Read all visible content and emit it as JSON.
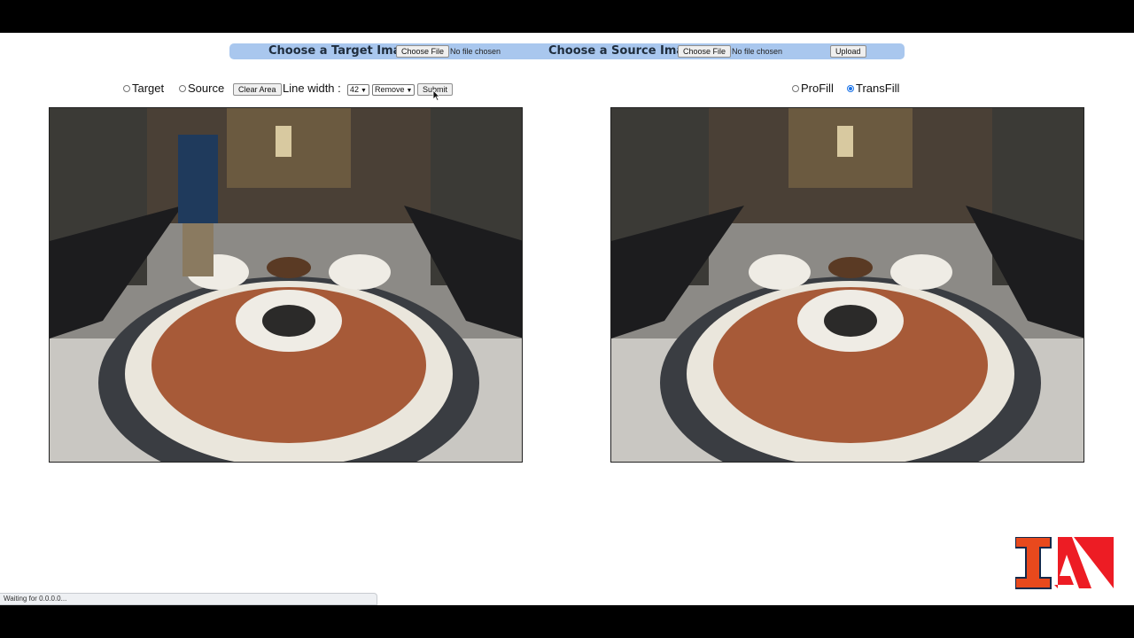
{
  "upload": {
    "target_label": "Choose a Target Image:",
    "source_label": "Choose a Source Image:",
    "choose_file": "Choose File",
    "no_file": "No file chosen",
    "upload_button": "Upload"
  },
  "toolbar": {
    "target_label": "Target",
    "source_label": "Source",
    "clear_area": "Clear Area",
    "line_width_label": "Line width :",
    "line_width_value": "42",
    "mode_value": "Remove",
    "submit": "Submit"
  },
  "method": {
    "profill_label": "ProFill",
    "transfill_label": "TransFill",
    "selected": "TransFill"
  },
  "status": {
    "text": "Waiting for 0.0.0.0..."
  },
  "colors": {
    "upload_bar": "#a9c7ee",
    "logo_orange": "#e8491d",
    "logo_navy": "#13294b",
    "logo_red": "#ed1c24"
  }
}
